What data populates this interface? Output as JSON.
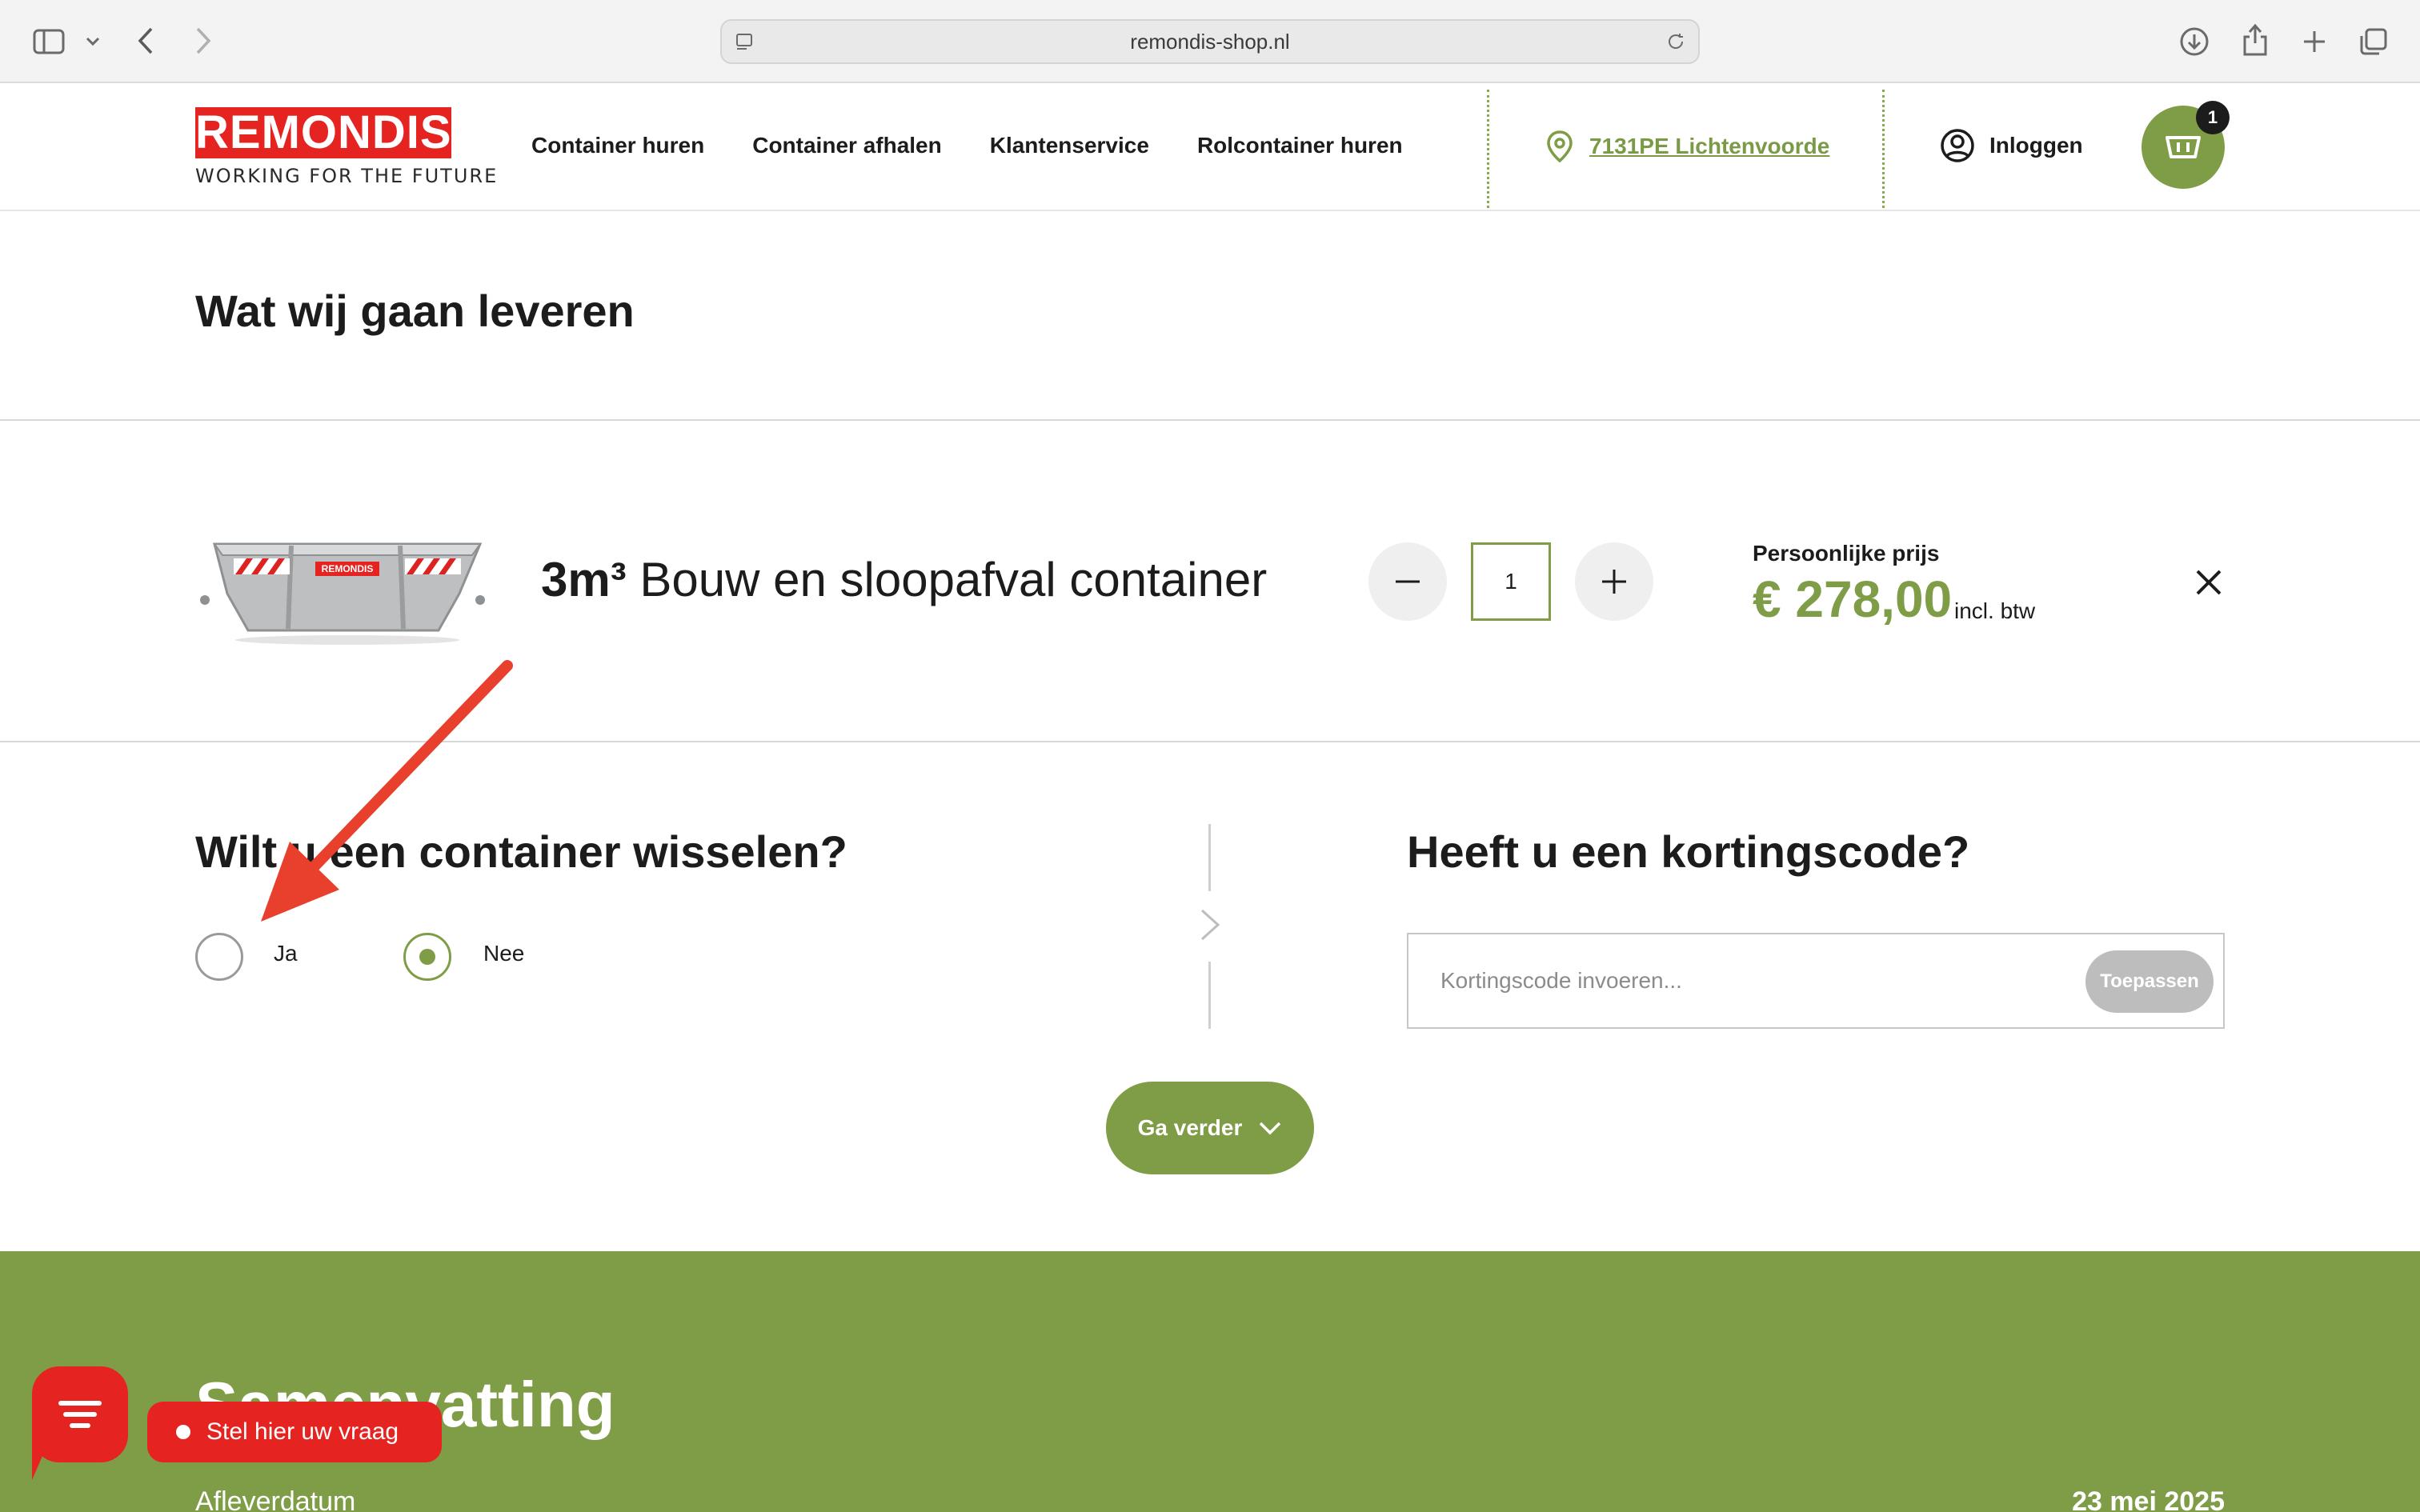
{
  "browser": {
    "url": "remondis-shop.nl"
  },
  "header": {
    "logo_text": "REMONDIS",
    "logo_tagline": "WORKING FOR THE FUTURE",
    "nav": [
      {
        "label": "Container huren"
      },
      {
        "label": "Container afhalen"
      },
      {
        "label": "Klantenservice"
      },
      {
        "label": "Rolcontainer huren"
      }
    ],
    "location": "7131PE Lichtenvoorde",
    "login_label": "Inloggen",
    "cart_count": "1"
  },
  "main": {
    "title": "Wat wij gaan leveren",
    "product": {
      "name_size": "3m³",
      "name_rest": "Bouw en sloopafval container",
      "quantity": "1",
      "price_label": "Persoonlijke prijs",
      "price": "€ 278,00",
      "price_suffix": "incl. btw",
      "image_label": "REMONDIS"
    },
    "swap": {
      "title": "Wilt u een container wisselen?",
      "options": [
        {
          "label": "Ja",
          "selected": false
        },
        {
          "label": "Nee",
          "selected": true
        }
      ]
    },
    "discount": {
      "title": "Heeft u een kortingscode?",
      "placeholder": "Kortingscode invoeren...",
      "apply_label": "Toepassen"
    },
    "next_label": "Ga verder"
  },
  "summary": {
    "title": "Samenvatting",
    "delivery_label": "Afleverdatum",
    "delivery_value": "23 mei 2025"
  },
  "chat": {
    "label": "Stel hier uw vraag"
  },
  "colors": {
    "brand_green": "#7f9d47",
    "brand_red": "#e52320",
    "annotation_arrow": "#e8402c"
  }
}
